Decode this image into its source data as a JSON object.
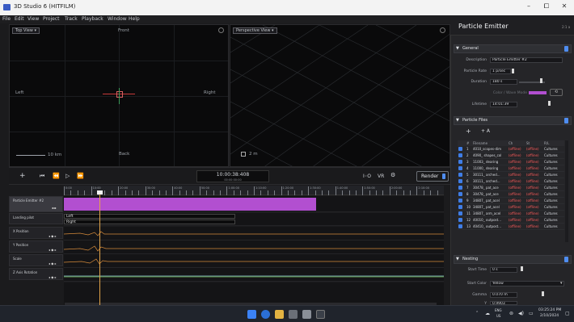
{
  "window": {
    "title": "3D Studio 6 (HITFILM)",
    "minimize": "–",
    "maximize": "⧠",
    "close": "✕"
  },
  "menu": [
    "File",
    "Edit",
    "View",
    "Project",
    "Track",
    "Playback",
    "Window",
    "Help"
  ],
  "left_viewport": {
    "view_select": "Top View  ▾",
    "front": "Front",
    "left": "Left",
    "right": "Right",
    "back": "Back",
    "scale": "10 km",
    "corner_icon": "maximize-icon"
  },
  "right_viewport": {
    "view_select": "Perspective View ▾",
    "scale": "2 m"
  },
  "transport": {
    "add": "+",
    "timecode": "10:00:38:408",
    "timecode_sub": "00:00:00:00",
    "mode1": "I◦O",
    "mode2": "VR",
    "render_label": "Render"
  },
  "ruler_labels": [
    "0:00",
    "10:00",
    "20:00",
    "30:00",
    "40:00",
    "50:00",
    "1:00:00",
    "1:10:00",
    "1:20:00",
    "1:30:00",
    "1:40:00",
    "1:50:00",
    "2:00:00",
    "2:10:00"
  ],
  "tracks": [
    {
      "name": "Particle Emitter #2"
    },
    {
      "name": "Landing pilot"
    },
    {
      "name": "X Position"
    },
    {
      "name": "Y Position"
    },
    {
      "name": "Scale"
    },
    {
      "name": "Z Axis Rotation"
    }
  ],
  "clips": {
    "left_label": "Left",
    "right_label": "Right"
  },
  "panel": {
    "title": "Particle Emitter",
    "title_suffix": "2:1 a",
    "general": {
      "header": "General",
      "fields": [
        {
          "label": "Description",
          "value": "Particle Emitter #2"
        },
        {
          "label": "Particle Rate",
          "value": "1 p/sec"
        },
        {
          "label": "Duration",
          "value": "180 s"
        },
        {
          "label": "Color / Wave Mode",
          "value": ""
        },
        {
          "label": "Lifetime",
          "value": "14:01:39"
        }
      ]
    },
    "particle_files": {
      "header": "Particle Files",
      "add": "+",
      "add_group": "+ A",
      "columns": [
        "#",
        "Filename",
        "Ch",
        "St",
        "R/L"
      ],
      "rows": [
        {
          "n": "1",
          "file": "4010_scopes-dim",
          "ch": "(offline)",
          "st": "(offline)",
          "rl": "Cultures"
        },
        {
          "n": "2",
          "file": "4090_ shapes_col",
          "ch": "(offline)",
          "st": "(offline)",
          "rl": "Cultures"
        },
        {
          "n": "3",
          "file": "11003_ dearing",
          "ch": "(offline)",
          "st": "(offline)",
          "rl": "Cultures"
        },
        {
          "n": "4",
          "file": "11000_ dearing",
          "ch": "(offline)",
          "st": "(offline)",
          "rl": "Cultures"
        },
        {
          "n": "5",
          "file": "30111_ arched...",
          "ch": "(offline)",
          "st": "(offline)",
          "rl": "Cultures"
        },
        {
          "n": "6",
          "file": "30111_ arched...",
          "ch": "(offline)",
          "st": "(offline)",
          "rl": "Cultures"
        },
        {
          "n": "7",
          "file": "30478_ pat_ace",
          "ch": "(offline)",
          "st": "(offline)",
          "rl": "Cultures"
        },
        {
          "n": "8",
          "file": "30478_ pat_ace",
          "ch": "(offline)",
          "st": "(offline)",
          "rl": "Cultures"
        },
        {
          "n": "9",
          "file": "34807_ pat_acel",
          "ch": "(offline)",
          "st": "(offline)",
          "rl": "Cultures"
        },
        {
          "n": "10",
          "file": "34807_ pat_acel",
          "ch": "(offline)",
          "st": "(offline)",
          "rl": "Cultures"
        },
        {
          "n": "11",
          "file": "34807_ arm_acel",
          "ch": "(offline)",
          "st": "(offline)",
          "rl": "Cultures"
        },
        {
          "n": "12",
          "file": "40010_ outpost...",
          "ch": "(offline)",
          "st": "(offline)",
          "rl": "Cultures"
        },
        {
          "n": "13",
          "file": "40410_ outpost...",
          "ch": "(offline)",
          "st": "(offline)",
          "rl": "Cultures"
        }
      ]
    },
    "nesting": {
      "header": "Nesting",
      "fields": [
        {
          "label": "Start Time",
          "value": "0 s"
        },
        {
          "label": "Start Color",
          "value": "Yellow"
        },
        {
          "label": "Gamma",
          "value": "0.070 m"
        },
        {
          "label": "Y",
          "value": "0.9903"
        }
      ]
    }
  },
  "taskbar": {
    "tray_lang1": "ENG",
    "tray_lang2": "US",
    "time": "03:25:24 PM",
    "date": "2/10/2024",
    "up_arrow": "⌃"
  },
  "colors": {
    "accent": "#4f8df0",
    "clip": "#b24fd0",
    "playhead": "#e3a54a",
    "offline": "#ff5c5c"
  }
}
